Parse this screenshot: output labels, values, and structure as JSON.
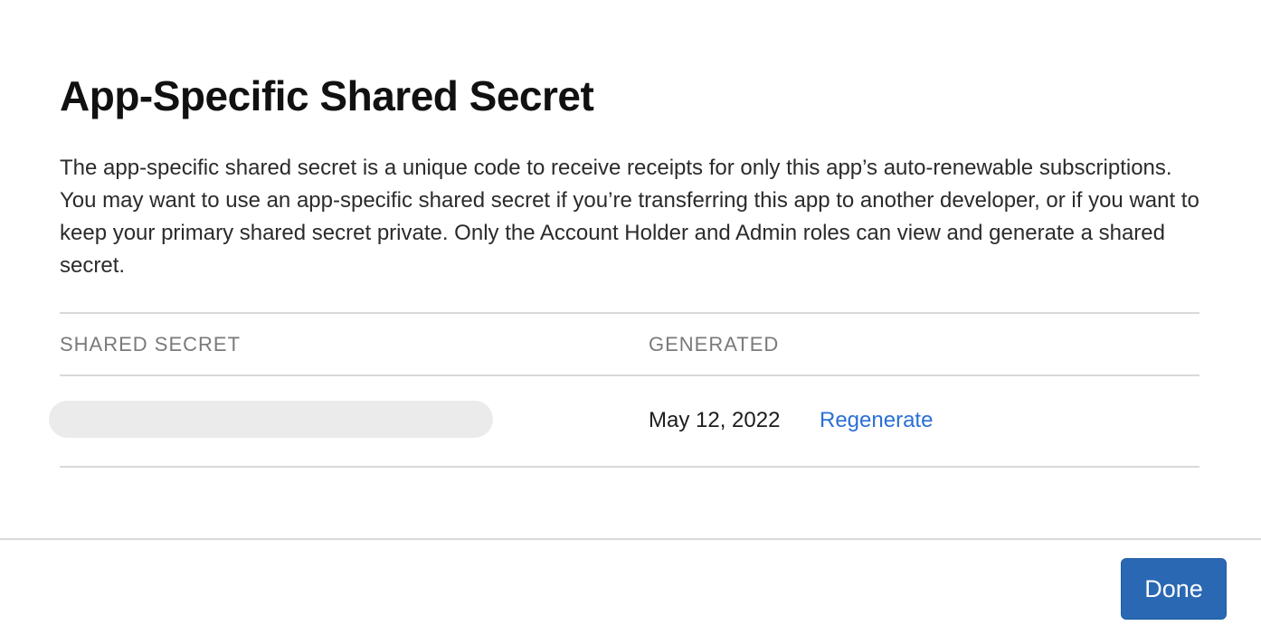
{
  "dialog": {
    "title": "App-Specific Shared Secret",
    "description": "The app-specific shared secret is a unique code to receive receipts for only this app’s auto-renewable subscriptions. You may want to use an app-specific shared secret if you’re transferring this app to another developer, or if you want to keep your primary shared secret private. Only the Account Holder and Admin roles can view and generate a shared secret."
  },
  "table": {
    "columns": {
      "shared_secret": "SHARED SECRET",
      "generated": "GENERATED"
    },
    "rows": [
      {
        "generated_date": "May 12, 2022",
        "action_label": "Regenerate"
      }
    ]
  },
  "footer": {
    "done_label": "Done"
  },
  "colors": {
    "accent": "#2a68b3",
    "link": "#2a6fd6",
    "divider": "#d9d9d9",
    "redacted_fill": "#ebebeb"
  }
}
